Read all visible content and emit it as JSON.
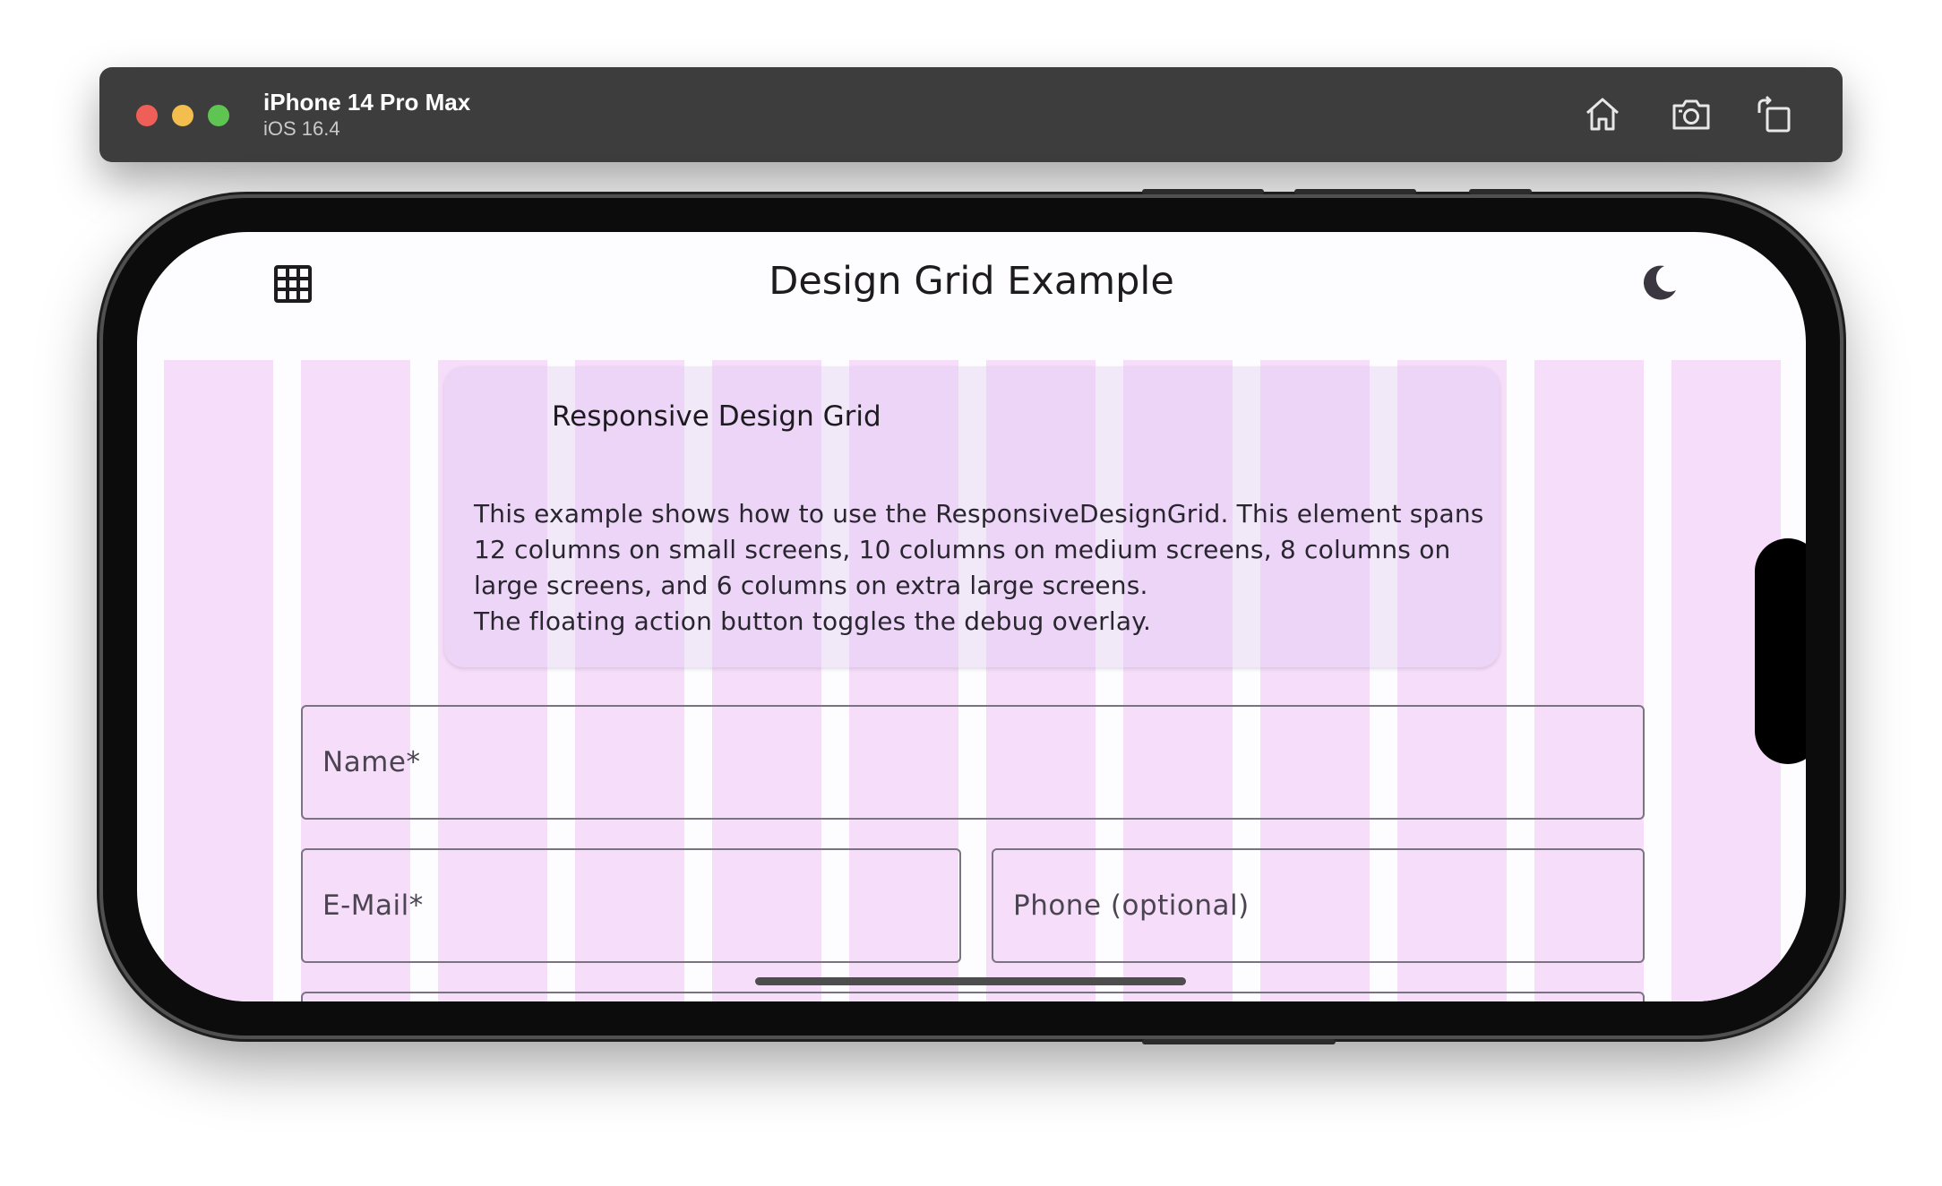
{
  "simulator": {
    "device_name": "iPhone 14 Pro Max",
    "os_version": "iOS 16.4",
    "buttons": [
      "home-icon",
      "screenshot-icon",
      "rotate-icon"
    ]
  },
  "app_bar": {
    "title": "Design Grid Example",
    "leading_icon": "grid-icon",
    "trailing_icon": "moon-icon"
  },
  "card": {
    "title": "Responsive Design Grid",
    "body_lines": [
      "This example shows how to use the ResponsiveDesignGrid. This element spans",
      "12 columns on small screens, 10 columns on medium screens, 8 columns on",
      "large screens, and 6 columns on extra large screens.",
      "The floating action button toggles the debug overlay."
    ]
  },
  "form": {
    "name_label": "Name*",
    "email_label": "E-Mail*",
    "phone_label": "Phone (optional)"
  },
  "colors": {
    "grid_column": "#f6ddfa",
    "window_bar": "#3d3d3d"
  }
}
